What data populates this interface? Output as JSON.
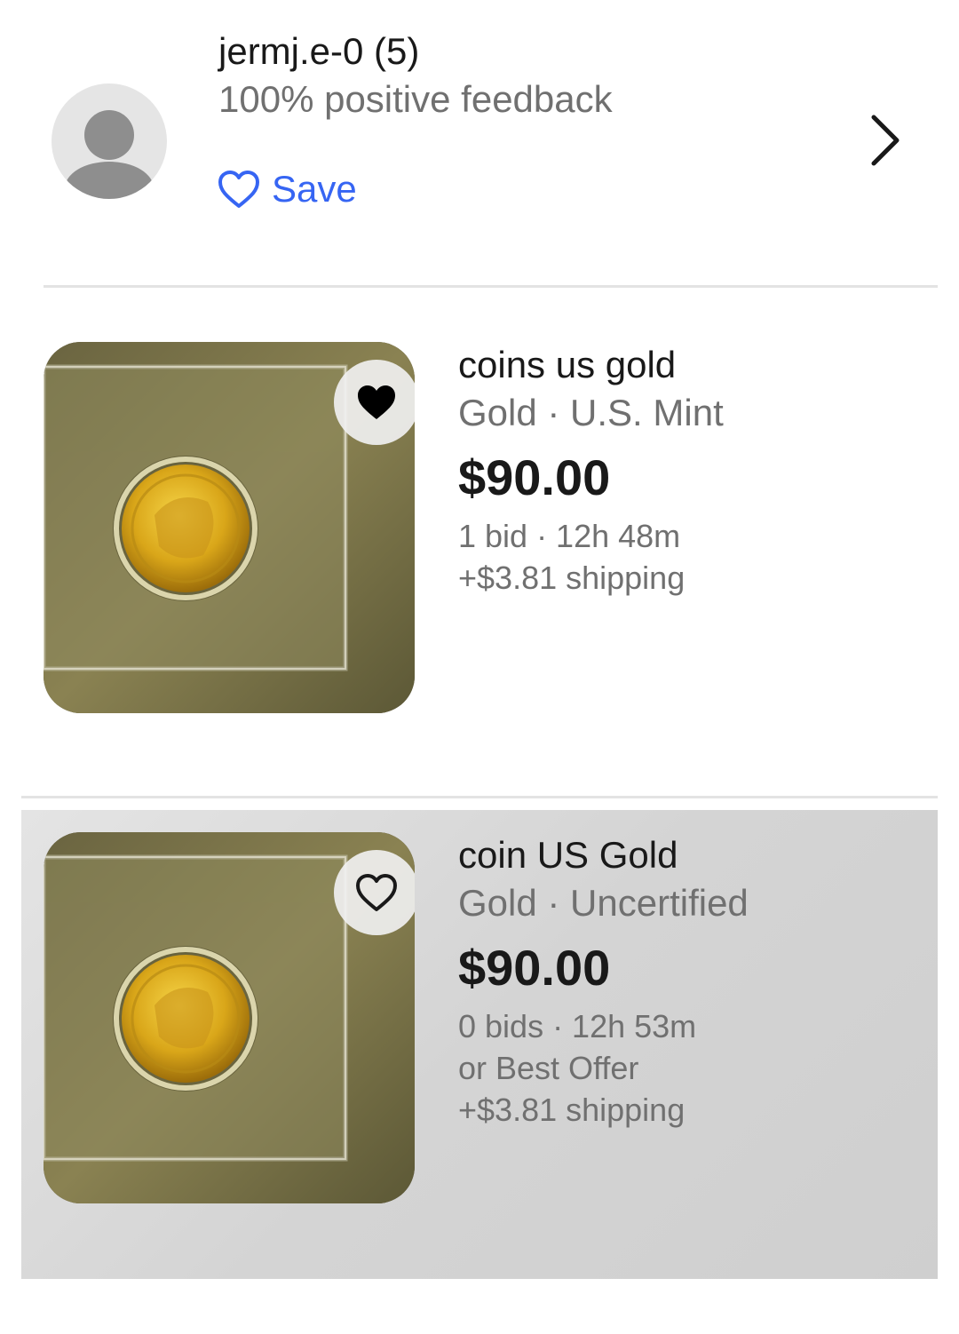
{
  "seller": {
    "name": "jermj.e-0 (5)",
    "feedback": "100% positive feedback",
    "save_label": "Save",
    "avatar_icon": "person-icon",
    "chevron_icon": "chevron-right-icon"
  },
  "listings": [
    {
      "title": "coins us gold",
      "subtitle": "Gold · U.S. Mint",
      "price": "$90.00",
      "bids": "1 bid · 12h 48m",
      "offer": "",
      "shipping": "+$3.81 shipping",
      "watched": true,
      "watch_icon": "heart-filled-icon"
    },
    {
      "title": "coin US Gold",
      "subtitle": "Gold · Uncertified",
      "price": "$90.00",
      "bids": "0 bids · 12h 53m",
      "offer": "or Best Offer",
      "shipping": "+$3.81 shipping",
      "watched": false,
      "watch_icon": "heart-outline-icon"
    }
  ],
  "colors": {
    "link_blue": "#3665f3",
    "secondary_text": "#707070",
    "primary_text": "#191919"
  }
}
